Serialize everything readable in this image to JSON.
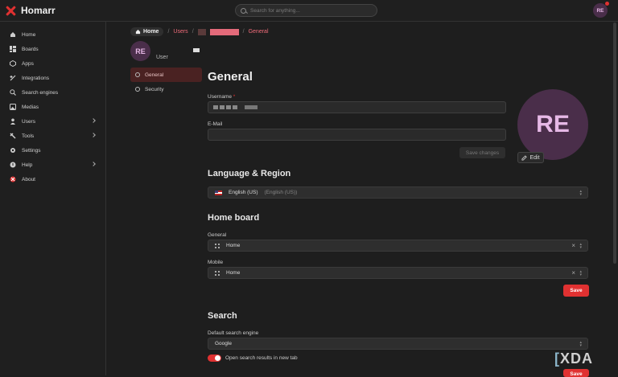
{
  "app": {
    "name": "Homarr"
  },
  "search": {
    "placeholder": "Search for anything..."
  },
  "user": {
    "initials": "RE",
    "role": "User"
  },
  "sidebar": {
    "items": [
      {
        "label": "Home",
        "icon": "home-icon"
      },
      {
        "label": "Boards",
        "icon": "boards-icon"
      },
      {
        "label": "Apps",
        "icon": "apps-icon"
      },
      {
        "label": "Integrations",
        "icon": "integrations-icon"
      },
      {
        "label": "Search engines",
        "icon": "search-engines-icon"
      },
      {
        "label": "Medias",
        "icon": "medias-icon"
      },
      {
        "label": "Users",
        "icon": "users-icon",
        "expandable": true
      },
      {
        "label": "Tools",
        "icon": "tools-icon",
        "expandable": true
      },
      {
        "label": "Settings",
        "icon": "settings-icon"
      },
      {
        "label": "Help",
        "icon": "help-icon",
        "expandable": true
      },
      {
        "label": "About",
        "icon": "about-icon"
      }
    ]
  },
  "breadcrumb": {
    "home": "Home",
    "users": "Users",
    "sep": "/",
    "current": "General"
  },
  "subnav": {
    "general": "General",
    "security": "Security"
  },
  "form": {
    "title": "General",
    "username_label": "Username",
    "required_mark": "*",
    "email_label": "E-Mail",
    "save_changes": "Save changes",
    "edit": "Edit"
  },
  "language": {
    "title": "Language & Region",
    "value": "English (US)",
    "value_native": "(English (US))"
  },
  "homeboard": {
    "title": "Home board",
    "general_label": "General",
    "general_value": "Home",
    "mobile_label": "Mobile",
    "mobile_value": "Home",
    "save": "Save"
  },
  "search_section": {
    "title": "Search",
    "engine_label": "Default search engine",
    "engine_value": "Google",
    "toggle_label": "Open search results in new tab",
    "toggle_on": true,
    "save": "Save"
  },
  "watermark": {
    "text": "XDA"
  },
  "colors": {
    "accent": "#e03131",
    "avatar_bg": "#4a2e4a",
    "avatar_fg": "#e6b8e6"
  }
}
